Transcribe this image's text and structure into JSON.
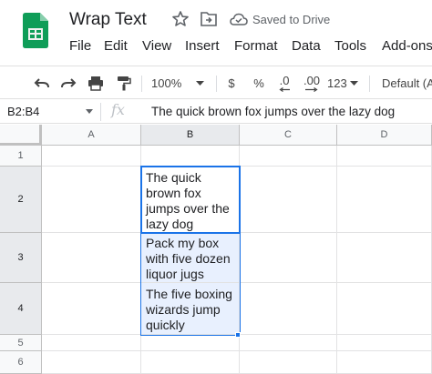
{
  "doc": {
    "title": "Wrap Text",
    "saved_status": "Saved to Drive"
  },
  "menu": [
    "File",
    "Edit",
    "View",
    "Insert",
    "Format",
    "Data",
    "Tools",
    "Add-ons"
  ],
  "toolbar": {
    "zoom": "100%",
    "currency": "$",
    "percent": "%",
    "decrease_decimal": ".0",
    "increase_decimal": ".00",
    "more_formats": "123",
    "font": "Default (A"
  },
  "formula_bar": {
    "name_box": "B2:B4",
    "fx": "fx",
    "formula": "The quick brown fox jumps over the lazy dog"
  },
  "columns": [
    "A",
    "B",
    "C",
    "D"
  ],
  "rows": [
    "1",
    "2",
    "3",
    "4",
    "5",
    "6"
  ],
  "cells": {
    "B2": [
      "The quick",
      "brown fox",
      "jumps over the",
      "lazy dog"
    ],
    "B3": [
      "Pack my box",
      "with five dozen",
      "liquor jugs"
    ],
    "B4": [
      "The five boxing",
      "wizards jump",
      "quickly"
    ]
  },
  "colors": {
    "selection": "#1a73e8",
    "selection_fill": "#e8f0fe",
    "sheets_green": "#0f9d58"
  }
}
